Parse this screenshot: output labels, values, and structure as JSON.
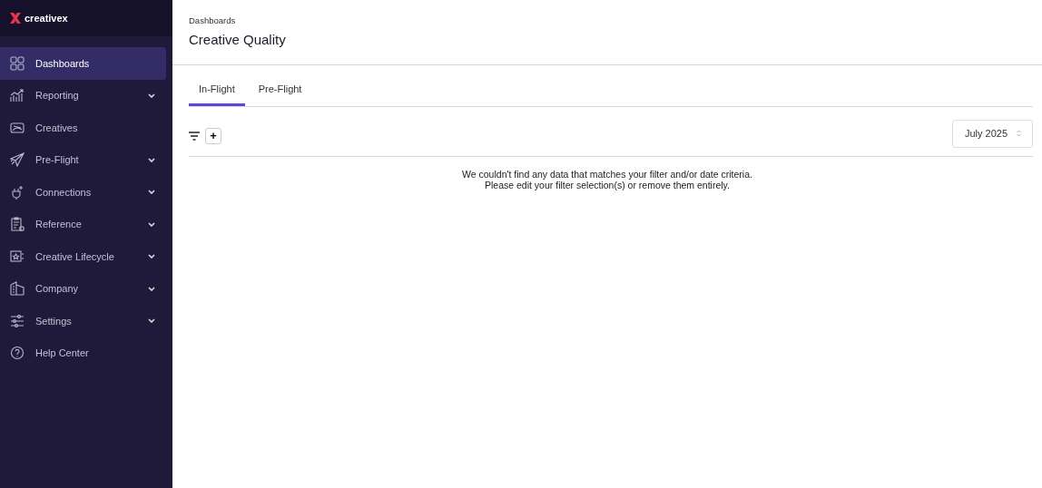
{
  "sidebar": {
    "logo": "creativex",
    "items": [
      {
        "label": "Dashboards",
        "selected": true,
        "expandable": false
      },
      {
        "label": "Reporting",
        "selected": false,
        "expandable": true
      },
      {
        "label": "Creatives",
        "selected": false,
        "expandable": false
      },
      {
        "label": "Pre-Flight",
        "selected": false,
        "expandable": true
      },
      {
        "label": "Connections",
        "selected": false,
        "expandable": true
      },
      {
        "label": "Reference",
        "selected": false,
        "expandable": true
      },
      {
        "label": "Creative Lifecycle",
        "selected": false,
        "expandable": true
      },
      {
        "label": "Company",
        "selected": false,
        "expandable": true
      },
      {
        "label": "Settings",
        "selected": false,
        "expandable": true
      },
      {
        "label": "Help Center",
        "selected": false,
        "expandable": false
      }
    ]
  },
  "header": {
    "breadcrumb": "Dashboards",
    "title": "Creative Quality"
  },
  "tabs": [
    {
      "label": "In-Flight",
      "selected": true
    },
    {
      "label": "Pre-Flight",
      "selected": false
    }
  ],
  "toolbar": {
    "add_button": "+",
    "date_select": "July 2025"
  },
  "empty_message": [
    "We couldn't find any data that matches your filter and/or date criteria.",
    "Please edit your filter selection(s) or remove them entirely."
  ]
}
